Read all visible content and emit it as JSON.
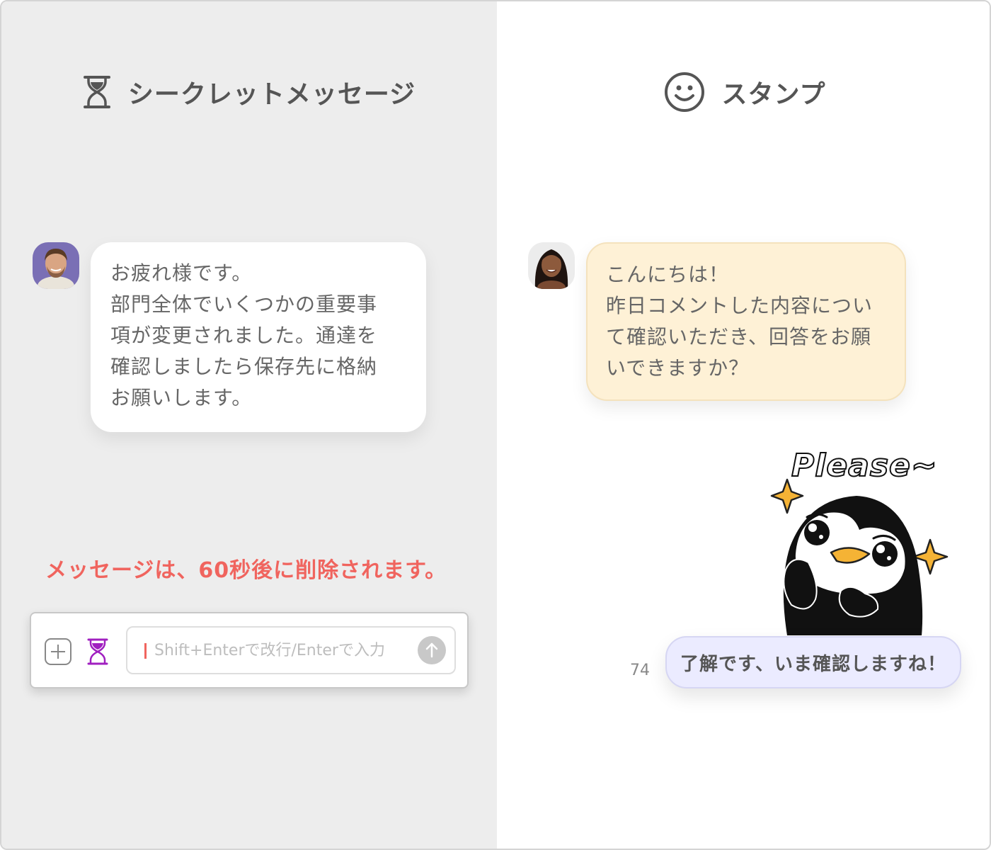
{
  "left_panel": {
    "title": "シークレットメッセージ",
    "title_icon": "hourglass-icon",
    "message": {
      "avatar": "male-user-avatar",
      "lines": [
        "お疲れ様です。",
        "部門全体でいくつかの重要事",
        "項が変更されました。通達を",
        "確認しましたら保存先に格納",
        "お願いします。"
      ]
    },
    "notice": "メッセージは、60秒後に削除されます。",
    "composer": {
      "plus_icon": "plus-icon",
      "secret_icon": "hourglass-icon",
      "placeholder": "Shift+Enterで改行/Enterで入力",
      "value": "",
      "send_icon": "arrow-up-icon"
    },
    "colors": {
      "background": "#ededed",
      "notice": "#f0645e",
      "secret_icon": "#a020c0"
    }
  },
  "right_panel": {
    "title": "スタンプ",
    "title_icon": "smiley-icon",
    "message": {
      "avatar": "female-user-avatar",
      "lines": [
        "こんにちは！",
        "昨日コメントした内容につい",
        "て確認いただき、回答をお願",
        "いできますか？"
      ]
    },
    "sticker": {
      "text": "Please~",
      "icon": "penguin-sticker"
    },
    "reply": {
      "read_count": "74",
      "text": "了解です、いま確認しますね！"
    },
    "colors": {
      "incoming_bubble": "#fef1d6",
      "reply_bubble": "#ebebff"
    }
  }
}
